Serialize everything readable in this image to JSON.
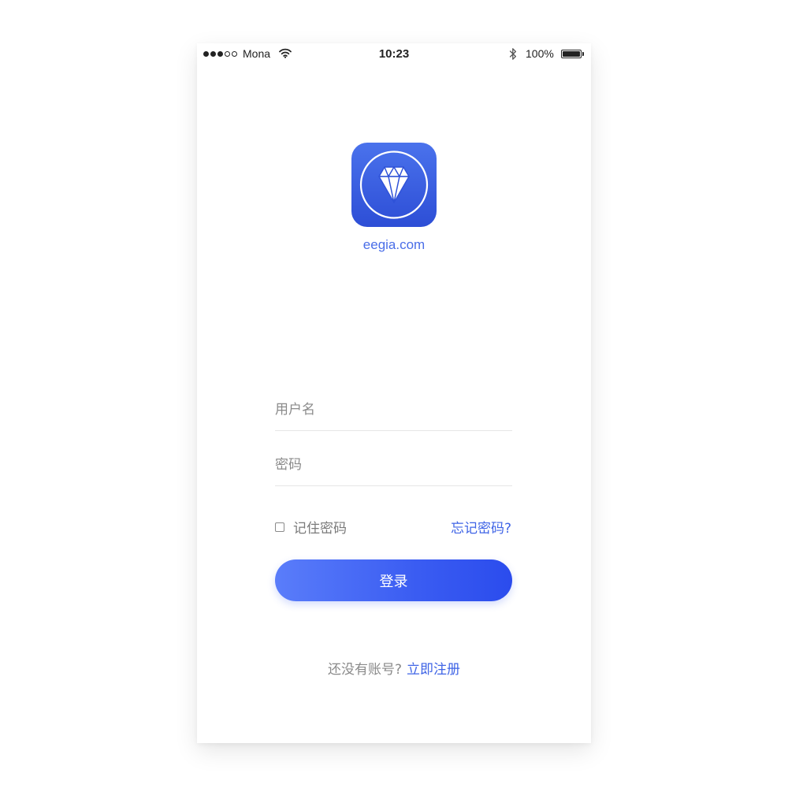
{
  "status_bar": {
    "carrier": "Mona",
    "time": "10:23",
    "battery": "100%",
    "signal_bars_filled": 3,
    "signal_bars_total": 5,
    "battery_level": 1.0,
    "icons": [
      "signal-dots-icon",
      "wifi-icon",
      "bluetooth-icon",
      "battery-icon"
    ]
  },
  "brand": {
    "site_name": "eegia.com",
    "logo_icon": "diamond-icon",
    "logo_color": "#3a5ee0"
  },
  "form": {
    "username_placeholder": "用户名",
    "username_value": "",
    "password_placeholder": "密码",
    "password_value": "",
    "remember_label": "记住密码",
    "remember_checked": false,
    "forgot_label": "忘记密码?",
    "login_label": "登录",
    "signup_prompt": "还没有账号?",
    "signup_link": "立即注册"
  },
  "colors": {
    "accent": "#3f64e6",
    "button_gradient_start": "#5a7dfa",
    "button_gradient_end": "#2b4ced",
    "muted_text": "#8a8a8a"
  }
}
